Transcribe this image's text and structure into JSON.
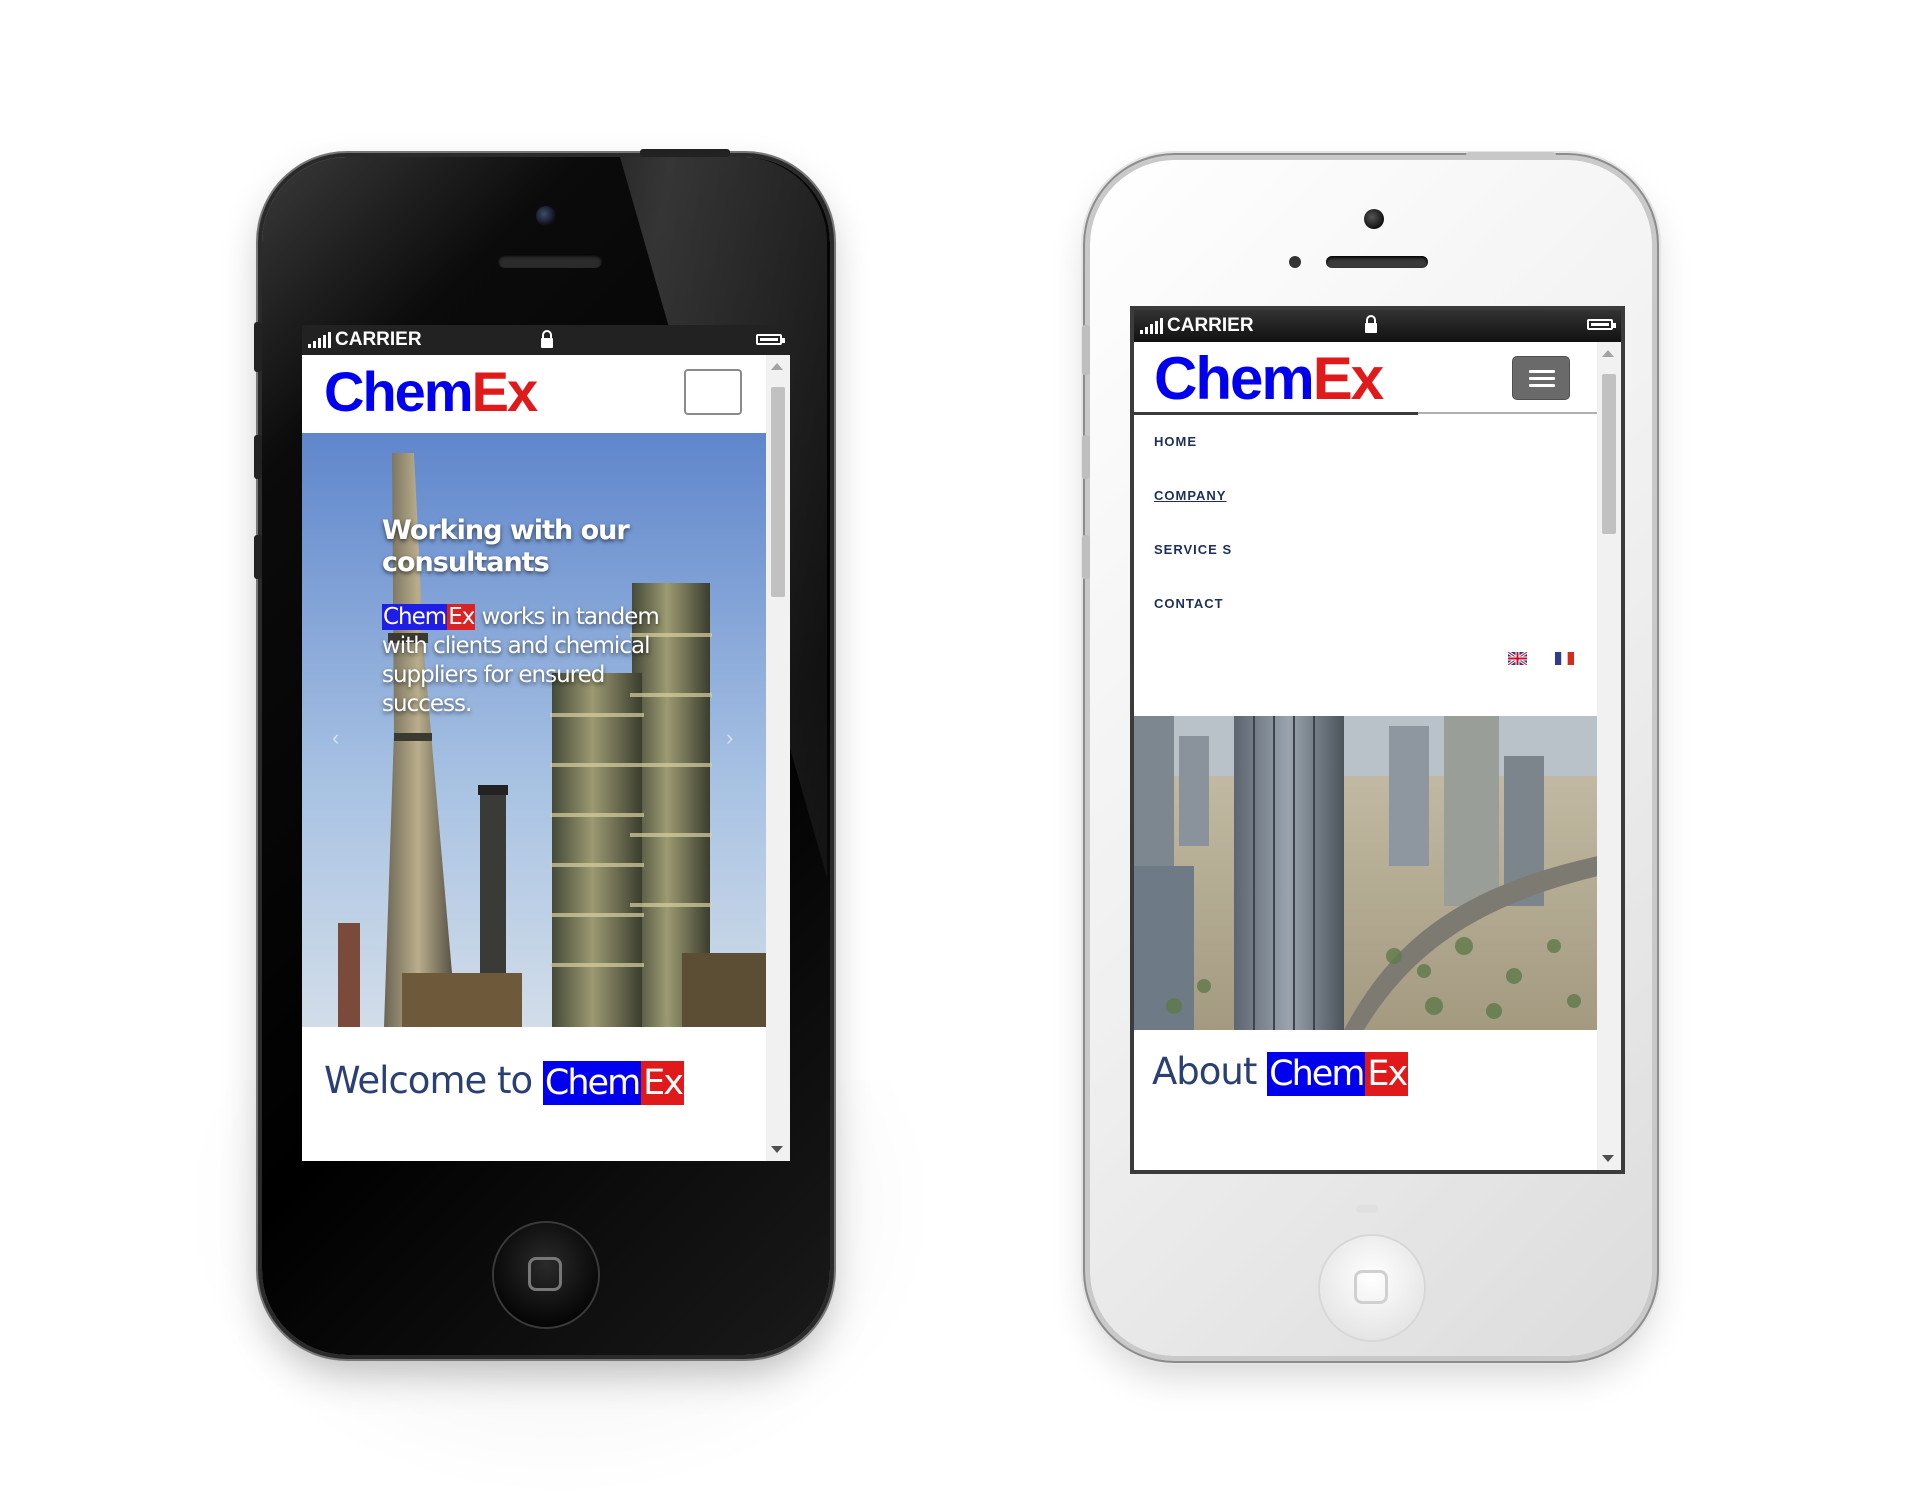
{
  "status_bar": {
    "carrier": "CARRIER"
  },
  "brand": {
    "chem": "Chem",
    "ex": "Ex"
  },
  "home_screen": {
    "hero_heading": "Working with our consultants",
    "hero_body": "works in tandem with clients and chemical suppliers for ensured success.",
    "prev_arrow": "‹",
    "next_arrow": "›",
    "welcome_prefix": "Welcome to"
  },
  "company_screen": {
    "menu": [
      {
        "label": "HOME"
      },
      {
        "label": "COMPANY"
      },
      {
        "label": "SERVICE S"
      },
      {
        "label": "CONTACT"
      }
    ],
    "languages": [
      "English",
      "Français"
    ],
    "about_prefix": "About"
  },
  "colors": {
    "brand_blue": "#0000ee",
    "brand_red": "#e01a1a",
    "heading_navy": "#2a3f73"
  }
}
